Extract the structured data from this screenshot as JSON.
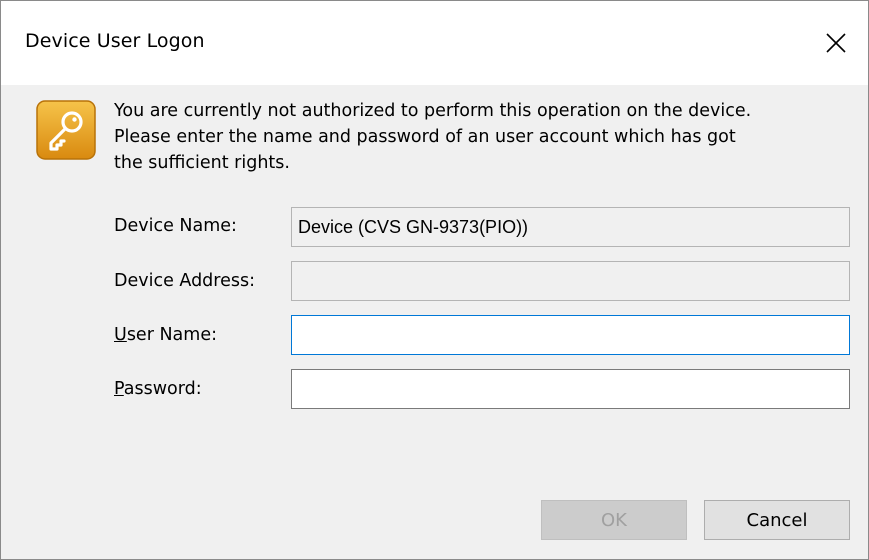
{
  "window": {
    "title": "Device User Logon",
    "close_icon": "close-icon"
  },
  "message": {
    "icon": "key-icon",
    "lines": [
      "You are currently not authorized to perform this operation on the device.",
      "Please enter the name and password of an user account which has got",
      "the sufficient rights."
    ]
  },
  "form": {
    "device_name": {
      "label": "Device Name:",
      "value": "Device (CVS GN-9373(PIO))"
    },
    "device_address": {
      "label": "Device Address:",
      "value": ""
    },
    "user_name": {
      "label_mnemonic": "U",
      "label_rest": "ser Name:",
      "value": ""
    },
    "password": {
      "label_mnemonic": "P",
      "label_rest": "assword:",
      "value": ""
    }
  },
  "buttons": {
    "ok_label": "OK",
    "cancel_label": "Cancel"
  },
  "colors": {
    "accent_focus": "#0078d7",
    "icon_orange": "#e8a020",
    "dialog_bg": "#f0f0f0"
  }
}
